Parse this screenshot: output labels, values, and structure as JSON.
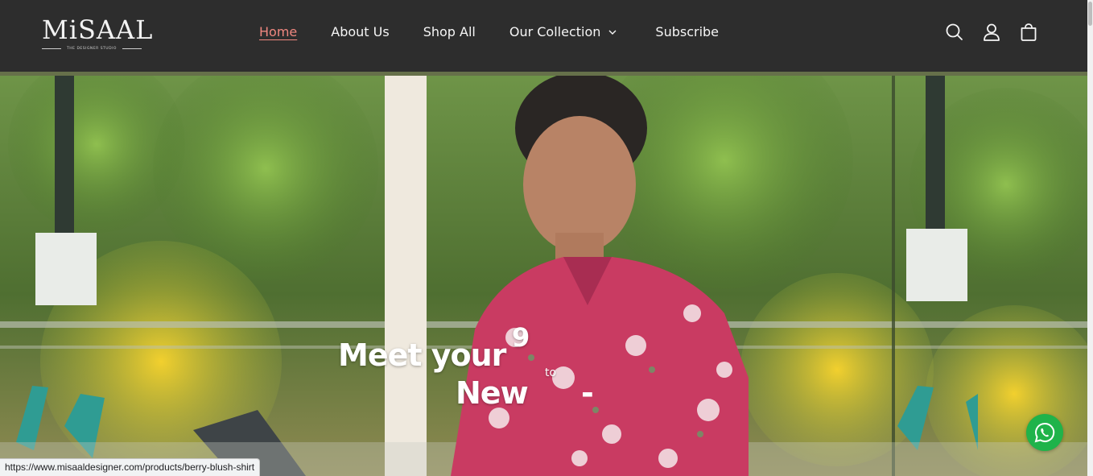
{
  "header": {
    "logo_text": "MiSAAL",
    "logo_tagline": "THE DESIGNER STUDIO",
    "background": "#2d2d2d"
  },
  "nav": {
    "items": [
      {
        "label": "Home",
        "active": true
      },
      {
        "label": "About Us"
      },
      {
        "label": "Shop All"
      },
      {
        "label": "Our Collection",
        "has_dropdown": true,
        "icon": "chevron-down-icon"
      },
      {
        "label": "Subscribe"
      }
    ],
    "active_color": "#f0877f"
  },
  "header_icons": [
    "search-icon",
    "account-icon",
    "cart-icon"
  ],
  "hero": {
    "line1": "Meet your",
    "number": "9",
    "to": "to",
    "line2": "New",
    "dash": "-"
  },
  "whatsapp": {
    "icon": "whatsapp-icon",
    "color": "#1fb34a"
  },
  "status_bar": {
    "url": "https://www.misaaldesigner.com/products/berry-blush-shirt"
  }
}
